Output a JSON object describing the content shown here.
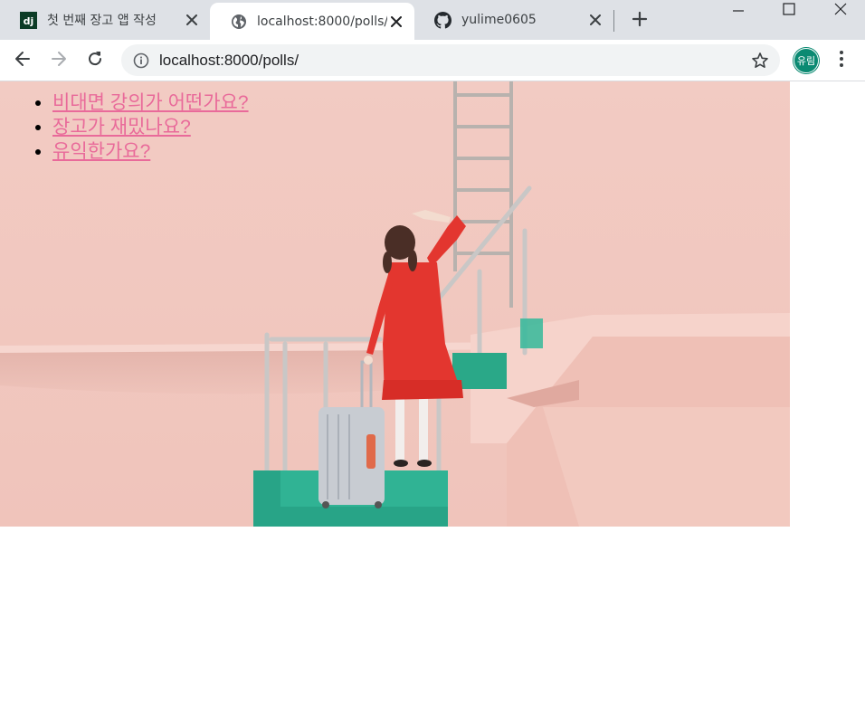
{
  "browser": {
    "tabs": [
      {
        "title": "첫 번째 장고 앱 작성",
        "favicon": "django-icon",
        "active": false
      },
      {
        "title": "localhost:8000/polls/",
        "favicon": "globe-icon",
        "active": true
      },
      {
        "title": "yulime0605",
        "favicon": "github-icon",
        "active": false
      }
    ],
    "address_bar": {
      "url": "localhost:8000/polls/"
    },
    "profile_initials": "유림",
    "favicon_django_text": "dj"
  },
  "page": {
    "questions": [
      {
        "text": "비대면 강의가 어떤가요?"
      },
      {
        "text": "장고가 재밌나요?"
      },
      {
        "text": "유익한가요?"
      }
    ],
    "link_color": "#e96a9a"
  },
  "theme": {
    "tabstrip_bg": "#dee1e6",
    "avatar_bg": "#0b8a72",
    "photo_wall": "#f0c8c0",
    "photo_dress": "#e83a36",
    "photo_stairs": "#2aa888"
  }
}
